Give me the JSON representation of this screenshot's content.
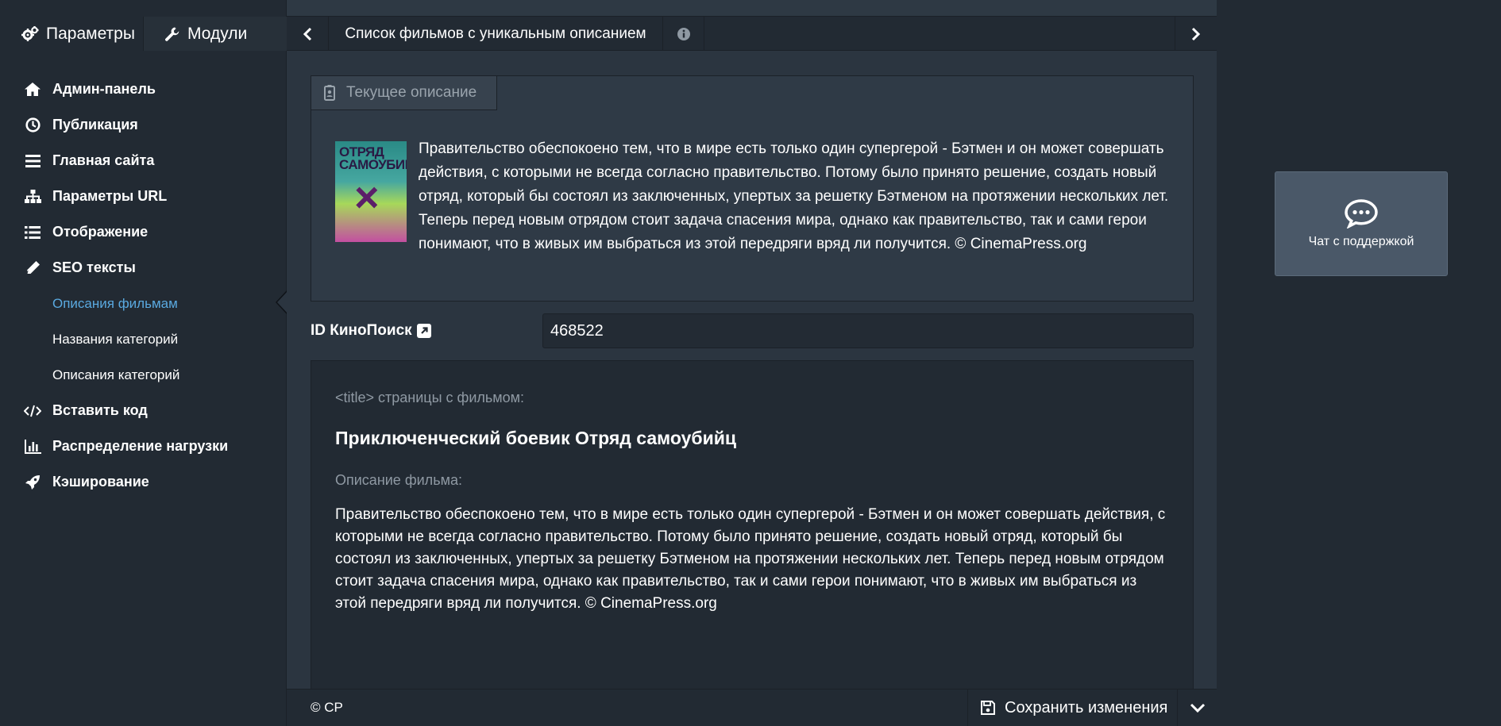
{
  "sidebar": {
    "tabs": [
      {
        "label": "Параметры",
        "icon": "cogs-icon"
      },
      {
        "label": "Модули",
        "icon": "wrench-icon"
      }
    ],
    "menu": [
      {
        "label": "Админ-панель",
        "icon": "home-icon"
      },
      {
        "label": "Публикация",
        "icon": "clock-icon"
      },
      {
        "label": "Главная сайта",
        "icon": "bars-icon"
      },
      {
        "label": "Параметры URL",
        "icon": "sitemap-icon"
      },
      {
        "label": "Отображение",
        "icon": "list-icon"
      },
      {
        "label": "SEO тексты",
        "icon": "pencil-icon"
      },
      {
        "label": "Описания фильмам",
        "sub": true,
        "active": true
      },
      {
        "label": "Названия категорий",
        "sub": true
      },
      {
        "label": "Описания категорий",
        "sub": true
      },
      {
        "label": "Вставить код",
        "icon": "code-icon"
      },
      {
        "label": "Распределение нагрузки",
        "icon": "bar-chart-icon"
      },
      {
        "label": "Кэширование",
        "icon": "rocket-icon"
      }
    ]
  },
  "nav": {
    "title": "Список фильмов с уникальным описанием"
  },
  "current": {
    "header": "Текущее описание",
    "poster_text": "ОТРЯД САМОУБИЙЦ",
    "text": "Правительство обеспокоено тем, что в мире есть только один супергерой - Бэтмен и он может совершать действия, с которыми не всегда согласно правительство. Потому было принято решение, создать новый отряд, который бы состоял из заключенных, упертых за решетку Бэтменом на протяжении нескольких лет. Теперь перед новым отрядом стоит задача спасения мира, однако как правительство, так и сами герои понимают, что в живых им выбраться из этой передряги вряд ли получится. © CinemaPress.org"
  },
  "kinopoisk": {
    "label": "ID КиноПоиск",
    "value": "468522"
  },
  "preview": {
    "title_label": "<title> страницы с фильмом:",
    "title": "Приключенческий боевик Отряд самоубийц",
    "desc_label": "Описание фильма:",
    "desc": "Правительство обеспокоено тем, что в мире есть только один супергерой - Бэтмен и он может совершать действия, с которыми не всегда согласно правительство. Потому было принято решение, создать новый отряд, который бы состоял из заключенных, упертых за решетку Бэтменом на протяжении нескольких лет. Теперь перед новым отрядом стоит задача спасения мира, однако как правительство, так и сами герои понимают, что в живых им выбраться из этой передряги вряд ли получится. © CinemaPress.org"
  },
  "footer": {
    "copyright": "© CP",
    "save_label": "Сохранить изменения"
  },
  "chat": {
    "label": "Чат с поддержкой"
  },
  "colors": {
    "accent": "#5aa9e0",
    "sidebar_bg": "#222a33",
    "main_bg": "#2b3540",
    "chat_bg": "#4a5868"
  }
}
